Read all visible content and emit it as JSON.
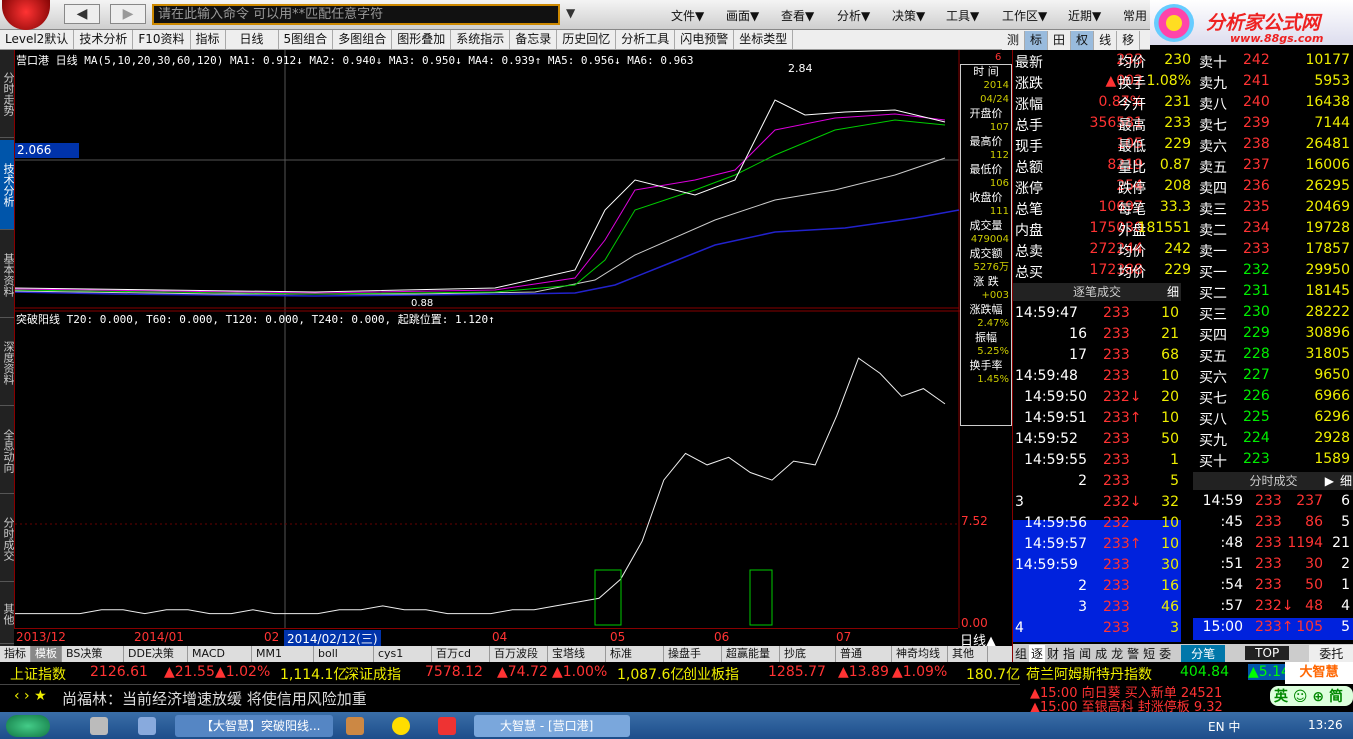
{
  "toolbar": {
    "cmd_placeholder": "请在此输入命令   可以用**匹配任意字符",
    "menus": [
      "文件▼",
      "画面▼",
      "查看▼",
      "分析▼",
      "决策▼",
      "工具▼",
      "工作区▼",
      "近期▼",
      "常用"
    ],
    "back": "◀",
    "forward": "▶"
  },
  "brand": {
    "name": "分析家公式网",
    "url": "www.88gs.com"
  },
  "tabs": [
    "Level2默认",
    "技术分析",
    "F10资料",
    "指标",
    "日线",
    "5图组合",
    "多图组合",
    "图形叠加",
    "系统指示",
    "备忘录",
    "历史回忆",
    "分析工具",
    "闪电预警",
    "坐标类型"
  ],
  "right_tabs": [
    "测",
    "标",
    "田",
    "权",
    "线",
    "移"
  ],
  "sidenav": [
    "分时走势",
    "技术分析",
    "基本资料",
    "深度资料",
    "全息动向",
    "分时成交",
    "其他"
  ],
  "chart": {
    "legend_ma": "营口港 日线  MA(5,10,20,30,60,120) MA1: 0.912↓ MA2: 0.940↓ MA3: 0.950↓ MA4: 0.939↑ MA5: 0.956↓ MA6: 0.963",
    "legend_ind": "突破阳线 T20: 0.000, T60: 0.000, T120: 0.000, T240: 0.000, 起跳位置: 1.120↑",
    "cursor_price": "2.066",
    "peak_label": "2.84",
    "low_label": "0.88",
    "axis_mid": "7.52",
    "axis_low": "0.00",
    "axis_top": "6"
  },
  "chart_data": {
    "type": "line",
    "series": [
      {
        "name": "突破阳线",
        "values": [
          3,
          3,
          3,
          3,
          4,
          4,
          3,
          4,
          4,
          3,
          3,
          4,
          3,
          3,
          3,
          4,
          4,
          5,
          4,
          4,
          3,
          3,
          3,
          4,
          4,
          5,
          6,
          7,
          12,
          22,
          38,
          45,
          42,
          44,
          40,
          38,
          43,
          42,
          55,
          70,
          66,
          60,
          62,
          58
        ]
      }
    ]
  },
  "pricebox": [
    {
      "l": "时 间",
      "v": "2014"
    },
    {
      "l": "",
      "v": "04/24"
    },
    {
      "l": "开盘价",
      "v": "107"
    },
    {
      "l": "最高价",
      "v": "112"
    },
    {
      "l": "最低价",
      "v": "106"
    },
    {
      "l": "收盘价",
      "v": "111"
    },
    {
      "l": "成交量",
      "v": "479004"
    },
    {
      "l": "成交额",
      "v": "5276万"
    },
    {
      "l": "涨 跌",
      "v": "+003"
    },
    {
      "l": "涨跌幅",
      "v": "2.47%"
    },
    {
      "l": "振幅",
      "v": "5.25%"
    },
    {
      "l": "换手率",
      "v": "1.45%"
    }
  ],
  "dates": [
    "2013/12",
    "2014/01",
    "02",
    "2014/02/12(三)",
    "04",
    "05",
    "06",
    "07"
  ],
  "period": "日线▲",
  "indicators": [
    "指标",
    "模板",
    "BS决策",
    "DDE决策",
    "MACD",
    "MM1",
    "boll",
    "cys1",
    "百万cd",
    "百万波段",
    "宝塔线",
    "标准",
    "操盘手",
    "超赢能量",
    "抄底",
    "普通",
    "神奇均线",
    "其他"
  ],
  "ticker": [
    {
      "name": "上证指数",
      "val": "2126.61",
      "chg": "▲21.55",
      "pct": "▲1.02%",
      "amt": "1,114.1亿"
    },
    {
      "name": "深证成指",
      "val": "7578.12",
      "chg": "▲74.72",
      "pct": "▲1.00%",
      "amt": "1,087.6亿"
    },
    {
      "name": "创业板指",
      "val": "1285.77",
      "chg": "▲13.89",
      "pct": "▲1.09%",
      "amt": "180.7亿"
    },
    {
      "name": "荷兰阿姆斯特丹指数",
      "val": "404.84",
      "chg": "▲5.14"
    }
  ],
  "news": {
    "arrows": "‹ › ★",
    "text": "尚福林：当前经济增速放缓 将使信用风险加重",
    "r1": "▲15:00 向日葵  买入新单 24521",
    "r2": "▲15:00 至银高科 封涨停板 9.32"
  },
  "quote": [
    [
      "最新",
      "233",
      "均价",
      "230"
    ],
    [
      "涨跌",
      "▲002",
      "换手",
      "1.08%"
    ],
    [
      "涨幅",
      "0.87%",
      "今开",
      "231"
    ],
    [
      "总手",
      "356581",
      "最高",
      "233"
    ],
    [
      "现手",
      "105",
      "最低",
      "229"
    ],
    [
      "总额",
      "8219",
      "量比",
      "0.87"
    ],
    [
      "涨停",
      "254",
      "跌停",
      "208"
    ],
    [
      "总笔",
      "10697",
      "每笔",
      "33.3"
    ],
    [
      "内盘",
      "175030",
      "外盘",
      "181551"
    ],
    [
      "总卖",
      "272244",
      "均价",
      "242"
    ],
    [
      "总买",
      "172388",
      "均价",
      "229"
    ]
  ],
  "sell": [
    [
      "卖十",
      "242",
      "10177"
    ],
    [
      "卖九",
      "241",
      "5953"
    ],
    [
      "卖八",
      "240",
      "16438"
    ],
    [
      "卖七",
      "239",
      "7144"
    ],
    [
      "卖六",
      "238",
      "26481"
    ],
    [
      "卖五",
      "237",
      "16006"
    ],
    [
      "卖四",
      "236",
      "26295"
    ],
    [
      "卖三",
      "235",
      "20469"
    ],
    [
      "卖二",
      "234",
      "19728"
    ],
    [
      "卖一",
      "233",
      "17857"
    ]
  ],
  "buy": [
    [
      "买一",
      "232",
      "29950"
    ],
    [
      "买二",
      "231",
      "18145"
    ],
    [
      "买三",
      "230",
      "28222"
    ],
    [
      "买四",
      "229",
      "30896"
    ],
    [
      "买五",
      "228",
      "31805"
    ],
    [
      "买六",
      "227",
      "9650"
    ],
    [
      "买七",
      "226",
      "6966"
    ],
    [
      "买八",
      "225",
      "6296"
    ],
    [
      "买九",
      "224",
      "2928"
    ],
    [
      "买十",
      "223",
      "1589"
    ]
  ],
  "trades_title": "逐笔成交",
  "trades_btn": "细",
  "trades": [
    [
      "14:59:47",
      "233",
      "10"
    ],
    [
      "16",
      "233",
      "21"
    ],
    [
      "17",
      "233",
      "68"
    ],
    [
      "14:59:48",
      "233",
      "10"
    ],
    [
      "14:59:50",
      "232↓",
      "20"
    ],
    [
      "14:59:51",
      "233↑",
      "10"
    ],
    [
      "14:59:52",
      "233",
      "50"
    ],
    [
      "14:59:55",
      "233",
      "1"
    ],
    [
      "2",
      "233",
      "5"
    ],
    [
      "3",
      "232↓",
      "32"
    ],
    [
      "14:59:56",
      "232",
      "10"
    ],
    [
      "14:59:57",
      "233↑",
      "10"
    ],
    [
      "14:59:59",
      "233",
      "30"
    ],
    [
      "2",
      "233",
      "16"
    ],
    [
      "3",
      "233",
      "46"
    ],
    [
      "4",
      "233",
      "3"
    ]
  ],
  "ticks_title": "分时成交",
  "ticks_btn1": "▶",
  "ticks_btn2": "细",
  "ticks": [
    [
      "14:59",
      "233",
      "237",
      "6"
    ],
    [
      ":45",
      "233",
      "86",
      "5"
    ],
    [
      ":48",
      "233",
      "1194",
      "21"
    ],
    [
      ":51",
      "233",
      "30",
      "2"
    ],
    [
      ":54",
      "233",
      "50",
      "1"
    ],
    [
      ":57",
      "232↓",
      "48",
      "4"
    ],
    [
      "15:00",
      "233↑",
      "105",
      "5"
    ]
  ],
  "bottom_tabs": [
    "组",
    "逐",
    "财",
    "指",
    "闻",
    "成",
    "龙",
    "警",
    "短",
    "委"
  ],
  "bottom_tabs2": [
    "分笔",
    "TOP",
    "委托"
  ],
  "tray": {
    "ime": "英",
    "lang": "中",
    "time": "13:26"
  },
  "tasks": [
    "【大智慧】突破阳线...",
    "大智慧 - [营口港]"
  ]
}
